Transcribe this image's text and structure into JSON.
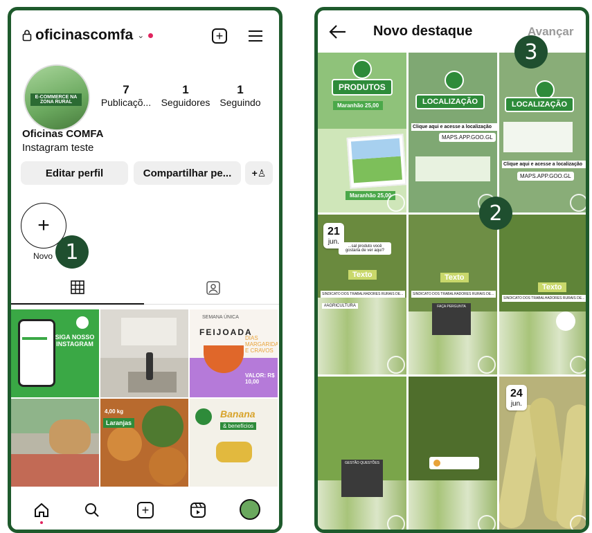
{
  "left": {
    "username": "oficinascomfa",
    "avatar_text": "E-COMMERCE NA ZONA RURAL",
    "stats": [
      {
        "value": "7",
        "label": "Publicaçõ..."
      },
      {
        "value": "1",
        "label": "Seguidores"
      },
      {
        "value": "1",
        "label": "Seguindo"
      }
    ],
    "name": "Oficinas COMFA",
    "bio": "Instagram teste",
    "edit_button": "Editar perfil",
    "share_button": "Compartilhar pe...",
    "new_highlight_label": "Novo",
    "badge": "1",
    "posts": [
      {
        "title": "SIGA NOSSO INSTAGRAM"
      },
      {
        "title": ""
      },
      {
        "title": "FEIJOADA",
        "subtitle": "SEMANA ÚNICA",
        "note": "DIAS MARGARIDAS E CRAVOS",
        "price": "VALOR: R$ 10,00"
      },
      {
        "title": ""
      },
      {
        "title": "Laranjas",
        "tag": "4,00 kg"
      },
      {
        "title": "Banana",
        "subtitle": "& benefícios"
      }
    ]
  },
  "right": {
    "title": "Novo destaque",
    "next": "Avançar",
    "badge_select": "2",
    "badge_next": "3",
    "cells": [
      {
        "label": "PRODUTOS",
        "small": "Maranhão 25,00",
        "small2": "Maranhão 25,00"
      },
      {
        "label": "LOCALIZAÇÃO",
        "link": "MAPS.APP.GOO.GL",
        "text": "Clique aqui e acesse a localização"
      },
      {
        "label": "LOCALIZAÇÃO",
        "link": "MAPS.APP.GOO.GL",
        "text": "Clique aqui e acesse a localização"
      },
      {
        "day": "21",
        "month": "jun.",
        "q": "...sal produto você gostaria de ver aqui?",
        "tag": "Texto",
        "bar": "SINDICATO DOS TRABALHADORES RURAIS DE...",
        "hashtag": "#AGRICULTURA"
      },
      {
        "tag": "Texto",
        "bar": "SINDICATO DOS TRABALHADORES RURAIS DE...",
        "note": "FAÇA PERGUNTA"
      },
      {
        "tag": "Texto",
        "bar": "SINDICATO DOS TRABALHADORES RURAIS DE..."
      },
      {
        "note": "GESTÃO QUESTÕES"
      },
      {
        "note": ""
      },
      {
        "day": "24",
        "month": "jun."
      }
    ]
  },
  "colors": {
    "frame": "#1e5a2c",
    "badge": "#1f4f2f",
    "brand_green": "#2e8b3a"
  }
}
